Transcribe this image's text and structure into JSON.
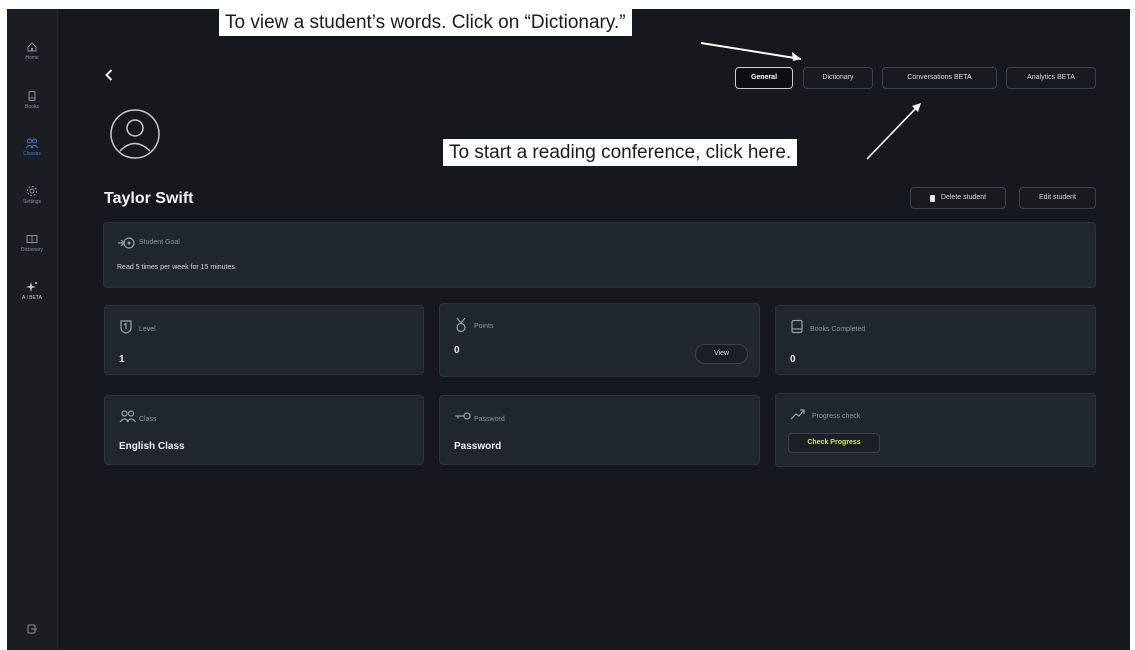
{
  "sidebar": {
    "items": [
      {
        "label": "Home",
        "icon": "home-icon"
      },
      {
        "label": "Books",
        "icon": "book-icon"
      },
      {
        "label": "Classes",
        "icon": "people-icon",
        "active": true
      },
      {
        "label": "Settings",
        "icon": "gear-icon"
      },
      {
        "label": "Dictionary",
        "icon": "open-book-icon"
      },
      {
        "label": "A I BETA",
        "icon": "sparkle-icon"
      }
    ],
    "bottom_icon": "logout-icon"
  },
  "annotations": {
    "dictionary_note": "To view a student’s words. Click on “Dictionary.”",
    "conference_note": "To start a reading conference, click here."
  },
  "tabs": [
    {
      "label": "General",
      "active": true
    },
    {
      "label": "Dictionary"
    },
    {
      "label": "Conversations BETA"
    },
    {
      "label": "Analytics BETA"
    }
  ],
  "student": {
    "name": "Taylor Swift",
    "delete_label": "Delete student",
    "edit_label": "Edit student"
  },
  "goal": {
    "label": "Student Goal",
    "text": "Read 5 times per week for 15 minutes."
  },
  "stats": {
    "level": {
      "label": "Level",
      "value": "1"
    },
    "points": {
      "label": "Points",
      "value": "0",
      "button": "View"
    },
    "books_completed": {
      "label": "Books Completed",
      "value": "0"
    },
    "class": {
      "label": "Class",
      "value": "English Class"
    },
    "password": {
      "label": "Password",
      "value": "Password"
    },
    "progress": {
      "label": "Progress check",
      "button": "Check Progress"
    }
  },
  "colors": {
    "background": "#15181c",
    "card": "#20262d",
    "accent": "#3d7bd6",
    "progress_button_text": "#d4e84a"
  }
}
